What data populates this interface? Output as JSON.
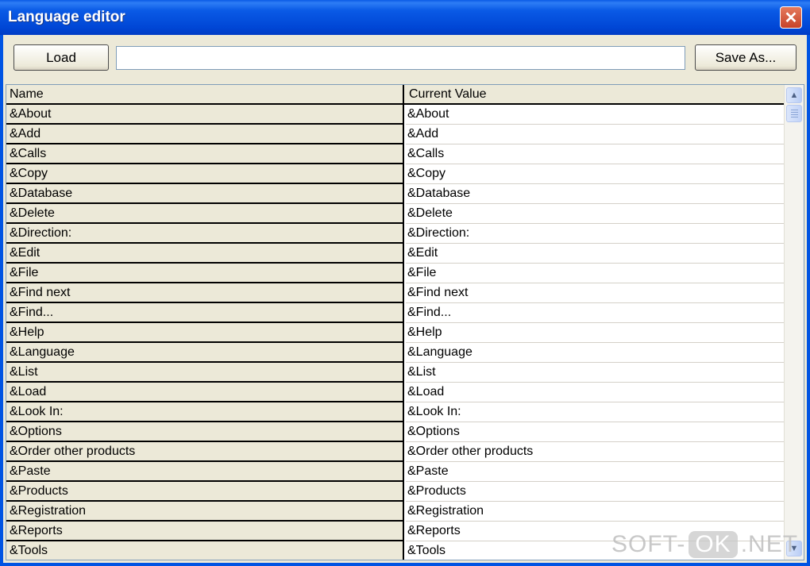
{
  "window": {
    "title": "Language editor",
    "close_glyph": "✕"
  },
  "toolbar": {
    "load_label": "Load",
    "path_value": "",
    "save_label": "Save As..."
  },
  "table": {
    "columns": [
      "Name",
      "Current Value"
    ],
    "rows": [
      {
        "name": "&About",
        "value": "&About"
      },
      {
        "name": "&Add",
        "value": "&Add"
      },
      {
        "name": "&Calls",
        "value": "&Calls"
      },
      {
        "name": "&Copy",
        "value": "&Copy"
      },
      {
        "name": "&Database",
        "value": "&Database"
      },
      {
        "name": "&Delete",
        "value": "&Delete"
      },
      {
        "name": "&Direction:",
        "value": "&Direction:"
      },
      {
        "name": "&Edit",
        "value": "&Edit"
      },
      {
        "name": "&File",
        "value": "&File"
      },
      {
        "name": "&Find next",
        "value": "&Find next"
      },
      {
        "name": "&Find...",
        "value": "&Find..."
      },
      {
        "name": "&Help",
        "value": "&Help"
      },
      {
        "name": "&Language",
        "value": "&Language"
      },
      {
        "name": "&List",
        "value": "&List"
      },
      {
        "name": "&Load",
        "value": "&Load"
      },
      {
        "name": "&Look In:",
        "value": "&Look In:"
      },
      {
        "name": "&Options",
        "value": "&Options"
      },
      {
        "name": "&Order other products",
        "value": "&Order other products"
      },
      {
        "name": "&Paste",
        "value": "&Paste"
      },
      {
        "name": "&Products",
        "value": "&Products"
      },
      {
        "name": "&Registration",
        "value": "&Registration"
      },
      {
        "name": "&Reports",
        "value": "&Reports"
      },
      {
        "name": "&Tools",
        "value": "&Tools"
      }
    ]
  },
  "scrollbar": {
    "up_glyph": "▲",
    "down_glyph": "▼"
  },
  "watermark": {
    "left": "SOFT-",
    "ok": "OK",
    "right": ".NET"
  },
  "colors": {
    "titlebar": "#0054e3",
    "client": "#ece9d8",
    "close": "#c7432a"
  }
}
